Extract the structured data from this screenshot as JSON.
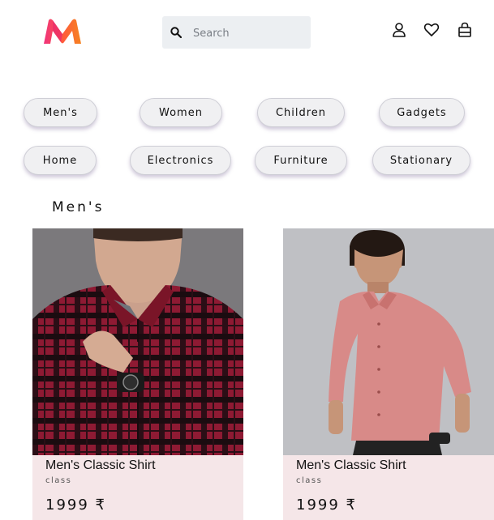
{
  "header": {
    "logo_icon": "myntra-logo-icon",
    "search": {
      "placeholder": "Search",
      "value": "",
      "icon": "search-icon"
    },
    "icons": [
      "user-icon",
      "heart-icon",
      "bag-icon"
    ]
  },
  "categories": [
    {
      "label": "Men's"
    },
    {
      "label": "Women"
    },
    {
      "label": "Children"
    },
    {
      "label": "Gadgets"
    },
    {
      "label": "Home"
    },
    {
      "label": "Electronics"
    },
    {
      "label": "Furniture"
    },
    {
      "label": "Stationary"
    }
  ],
  "section": {
    "title": "Men's"
  },
  "products": [
    {
      "name": "Men's Classic Shirt",
      "subtitle": "class",
      "price": "1999 ₹",
      "image": "red-checked-shirt-photo"
    },
    {
      "name": "Men's Classic Shirt",
      "subtitle": "class",
      "price": "1999 ₹",
      "image": "pink-shirt-photo"
    }
  ],
  "colors": {
    "chip_bg": "#f0f0f2",
    "card_info_bg": "#f5e6e8",
    "search_bg": "#eceff2"
  }
}
